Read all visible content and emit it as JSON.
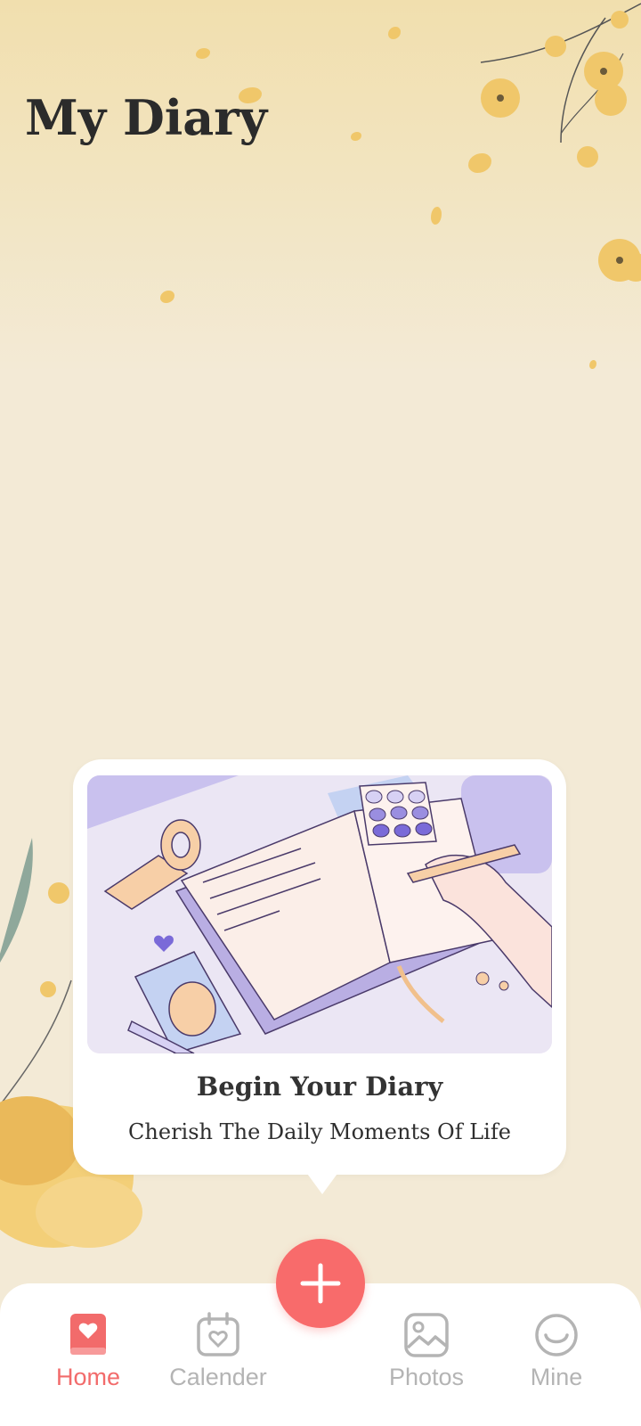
{
  "header": {
    "title": "My Diary"
  },
  "empty_state": {
    "title": "Begin Your Diary",
    "subtitle": "Cherish The Daily Moments Of Life"
  },
  "fab": {
    "icon": "plus-icon"
  },
  "tabs": [
    {
      "label": "Home",
      "icon": "diary-heart-icon",
      "active": true
    },
    {
      "label": "Calender",
      "icon": "calendar-heart-icon",
      "active": false
    },
    {
      "label": "Photos",
      "icon": "image-icon",
      "active": false
    },
    {
      "label": "Mine",
      "icon": "smile-icon",
      "active": false
    }
  ],
  "colors": {
    "accent": "#f86b6b",
    "background": "#f3ead6",
    "inactive_tab": "#b4b4b4"
  }
}
